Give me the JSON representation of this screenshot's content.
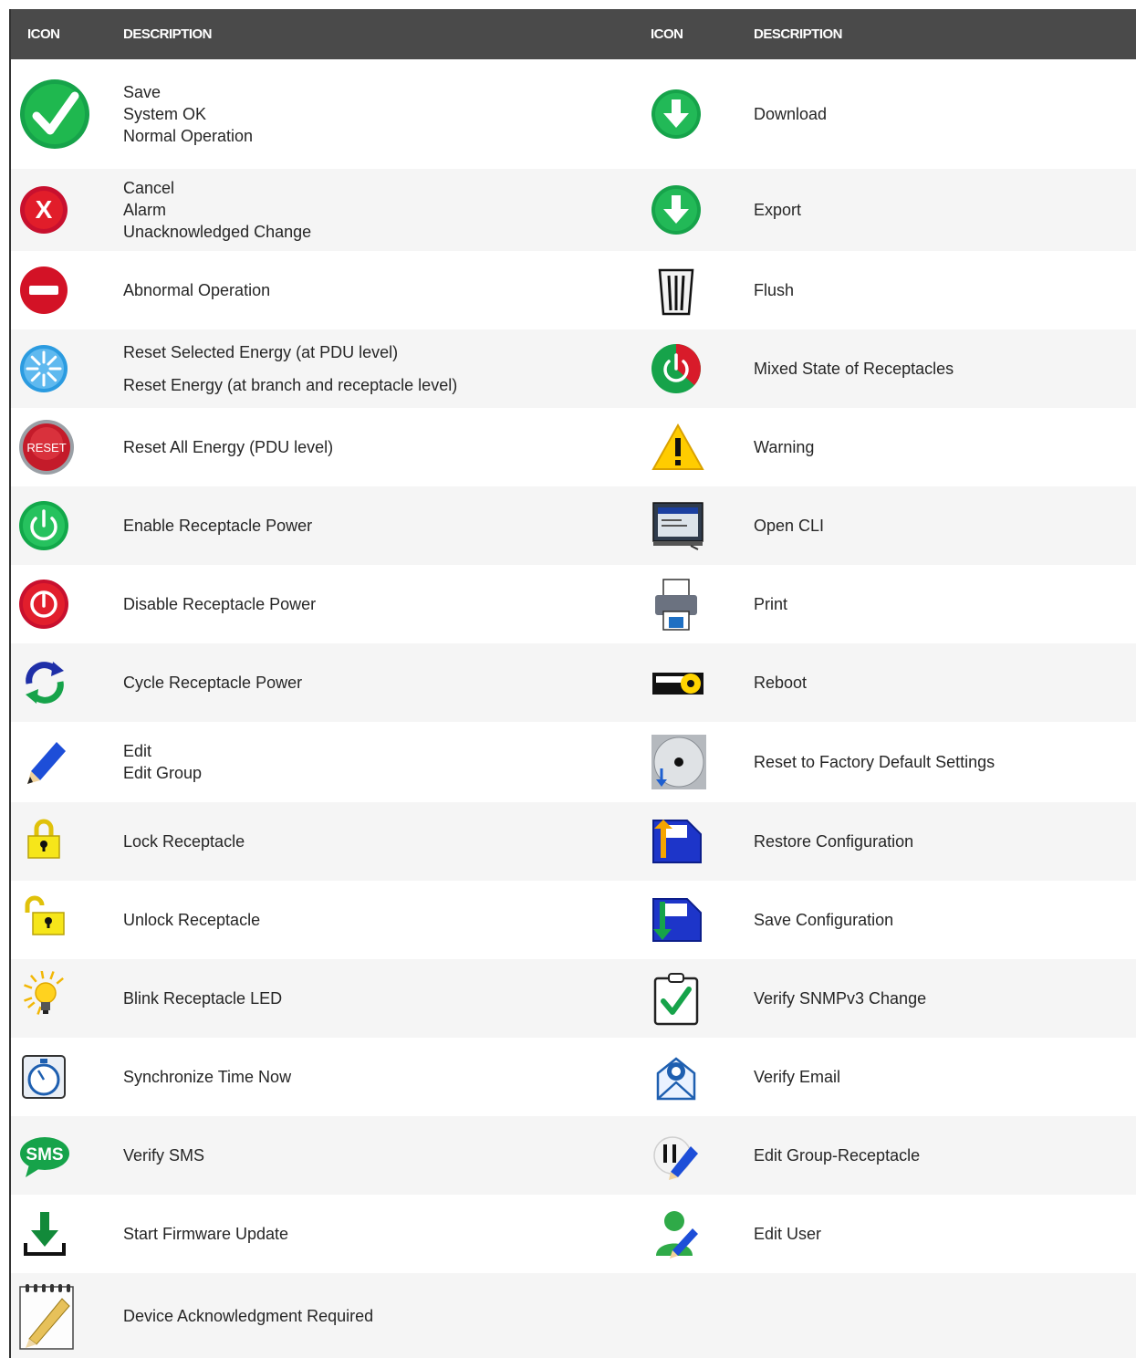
{
  "header": {
    "icon_col_left": "ICON",
    "desc_col_left": "DESCRIPTION",
    "icon_col_right": "ICON",
    "desc_col_right": "DESCRIPTION"
  },
  "rows": [
    {
      "left_icon": "green-check-icon",
      "left_lines": [
        "Save",
        "System OK",
        "Normal Operation"
      ],
      "right_icon": "download-arrow-icon",
      "right_lines": [
        "Download"
      ]
    },
    {
      "left_icon": "red-x-icon",
      "left_lines": [
        "Cancel",
        "Alarm",
        "Unacknowledged Change"
      ],
      "right_icon": "export-arrow-icon",
      "right_lines": [
        "Export"
      ]
    },
    {
      "left_icon": "no-entry-icon",
      "left_lines": [
        "Abnormal Operation"
      ],
      "right_icon": "trash-can-icon",
      "right_lines": [
        "Flush"
      ]
    },
    {
      "left_icon": "reset-burst-icon",
      "left_lines": [
        "Reset Selected Energy (at PDU level)",
        "Reset Energy (at branch and receptacle level)"
      ],
      "right_icon": "mixed-state-icon",
      "right_lines": [
        "Mixed State of Receptacles"
      ]
    },
    {
      "left_icon": "reset-button-icon",
      "left_lines": [
        "Reset All Energy (PDU level)"
      ],
      "right_icon": "warning-triangle-icon",
      "right_lines": [
        "Warning"
      ],
      "left_icon_text": "RESET"
    },
    {
      "left_icon": "power-on-icon",
      "left_lines": [
        "Enable Receptacle Power"
      ],
      "right_icon": "monitor-cli-icon",
      "right_lines": [
        "Open CLI"
      ]
    },
    {
      "left_icon": "power-off-icon",
      "left_lines": [
        "Disable Receptacle Power"
      ],
      "right_icon": "printer-icon",
      "right_lines": [
        "Print"
      ]
    },
    {
      "left_icon": "cycle-arrows-icon",
      "left_lines": [
        "Cycle Receptacle Power"
      ],
      "right_icon": "reboot-key-icon",
      "right_lines": [
        "Reboot"
      ]
    },
    {
      "left_icon": "pencil-icon",
      "left_lines": [
        "Edit",
        "Edit Group"
      ],
      "right_icon": "factory-disc-icon",
      "right_lines": [
        "Reset to Factory Default Settings"
      ]
    },
    {
      "left_icon": "padlock-locked-icon",
      "left_lines": [
        "Lock Receptacle"
      ],
      "right_icon": "restore-config-icon",
      "right_lines": [
        "Restore Configuration"
      ]
    },
    {
      "left_icon": "padlock-unlocked-icon",
      "left_lines": [
        "Unlock Receptacle"
      ],
      "right_icon": "save-config-icon",
      "right_lines": [
        "Save Configuration"
      ]
    },
    {
      "left_icon": "light-bulb-icon",
      "left_lines": [
        "Blink Receptacle LED"
      ],
      "right_icon": "clipboard-check-icon",
      "right_lines": [
        "Verify SNMPv3 Change"
      ]
    },
    {
      "left_icon": "stopwatch-icon",
      "left_lines": [
        "Synchronize Time Now"
      ],
      "right_icon": "email-envelope-icon",
      "right_lines": [
        "Verify Email"
      ]
    },
    {
      "left_icon": "sms-bubble-icon",
      "left_lines": [
        "Verify SMS"
      ],
      "right_icon": "edit-group-receptacle-icon",
      "right_lines": [
        "Edit Group-Receptacle"
      ],
      "left_icon_text": "SMS"
    },
    {
      "left_icon": "firmware-download-icon",
      "left_lines": [
        "Start Firmware Update"
      ],
      "right_icon": "edit-user-icon",
      "right_lines": [
        "Edit User"
      ]
    },
    {
      "left_icon": "notepad-pencil-icon",
      "left_lines": [
        "Device Acknowledgment Required"
      ],
      "right_icon": "",
      "right_lines": []
    }
  ]
}
